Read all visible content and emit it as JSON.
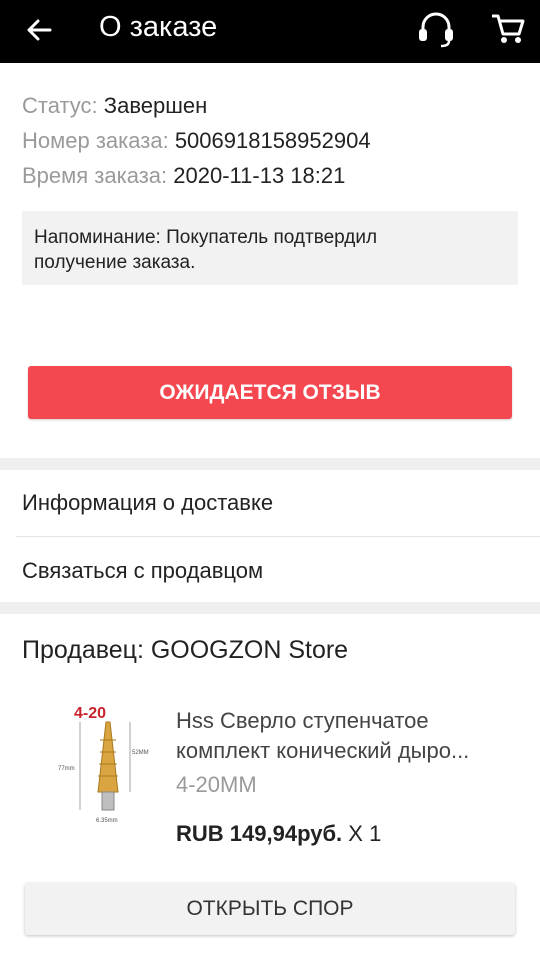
{
  "header": {
    "title": "О заказе"
  },
  "order": {
    "status_label": "Статус:",
    "status_value": "Завершен",
    "number_label": "Номер заказа:",
    "number_value": "5006918158952904",
    "time_label": "Время заказа:",
    "time_value": "2020-11-13 18:21"
  },
  "reminder": {
    "line1": "Напоминание: Покупатель подтвердил",
    "line2": "получение заказа."
  },
  "actions": {
    "review_label": "ОЖИДАЕТСЯ ОТЗЫВ",
    "dispute_label": "ОТКРЫТЬ СПОР"
  },
  "menu": {
    "delivery_info": "Информация о доставке",
    "contact_seller": "Связаться с продавцом"
  },
  "seller": {
    "label": "Продавец: GOOGZON Store"
  },
  "product": {
    "image_badge": "4-20",
    "image_dim_left": "77mm",
    "image_dim_right": "52MM",
    "image_dim_bottom": "6.35mm",
    "title_line1": "Hss Сверло ступенчатое",
    "title_line2": "комплект конический дыро...",
    "variant": "4-20MM",
    "price": "RUB 149,94руб.",
    "quantity": "X 1"
  },
  "colors": {
    "accent": "#f5474f",
    "topbar": "#000000",
    "muted": "#9a9a9a"
  },
  "icons": [
    "back-arrow-icon",
    "headset-support-icon",
    "shopping-cart-icon"
  ]
}
